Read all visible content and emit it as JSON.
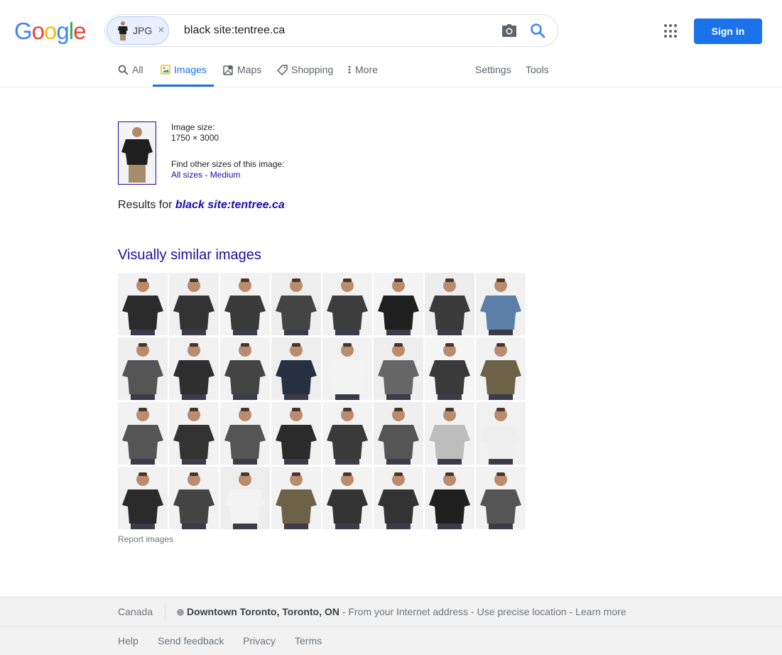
{
  "logo": {
    "letters": [
      "G",
      "o",
      "o",
      "g",
      "l",
      "e"
    ],
    "colors": [
      "#4285f4",
      "#ea4335",
      "#fbbc05",
      "#4285f4",
      "#34a853",
      "#ea4335"
    ]
  },
  "search": {
    "chip_label": "JPG",
    "chip_close": "×",
    "query": "black site:tentree.ca"
  },
  "header": {
    "signin_label": "Sign in"
  },
  "tabs": [
    {
      "label": "All",
      "icon": "search-icon"
    },
    {
      "label": "Images",
      "icon": "image-icon",
      "active": true
    },
    {
      "label": "Maps",
      "icon": "map-icon"
    },
    {
      "label": "Shopping",
      "icon": "tag-icon"
    },
    {
      "label": "More",
      "icon": "more-vert-icon"
    }
  ],
  "tools": {
    "settings": "Settings",
    "tools": "Tools"
  },
  "image_info": {
    "size_label": "Image size:",
    "size_value": "1750 × 3000",
    "find_label": "Find other sizes of this image:",
    "all_sizes": "All sizes",
    "separator": " - ",
    "medium": "Medium"
  },
  "results": {
    "prefix": "Results for ",
    "query": "black site:tentree.ca"
  },
  "similar": {
    "title": "Visually similar images",
    "report": "Report images",
    "tiles": [
      {
        "shirt": "#2b2b2b",
        "bg": "#f2f2f2"
      },
      {
        "shirt": "#333",
        "bg": "#f0f0f0"
      },
      {
        "shirt": "#3a3a3a",
        "bg": "#f3f3f3"
      },
      {
        "shirt": "#444",
        "bg": "#eeeeee"
      },
      {
        "shirt": "#3d3d3d",
        "bg": "#f2f2f2"
      },
      {
        "shirt": "#1f1f1f",
        "bg": "#f4f4f4"
      },
      {
        "shirt": "#3a3a3a",
        "bg": "#ededed"
      },
      {
        "shirt": "#5b7fa8",
        "bg": "#f1f1f1"
      },
      {
        "shirt": "#555",
        "bg": "#efefef"
      },
      {
        "shirt": "#2e2e2e",
        "bg": "#f1f1f1"
      },
      {
        "shirt": "#444",
        "bg": "#f2f2f2"
      },
      {
        "shirt": "#263040",
        "bg": "#eeeeee"
      },
      {
        "shirt": "#f4f4f4",
        "bg": "#f2f2f2"
      },
      {
        "shirt": "#666",
        "bg": "#eeeeee"
      },
      {
        "shirt": "#3a3a3a",
        "bg": "#f5f5f5"
      },
      {
        "shirt": "#6b6248",
        "bg": "#f2f2f2"
      },
      {
        "shirt": "#555",
        "bg": "#f2f2f2"
      },
      {
        "shirt": "#333",
        "bg": "#f2f2f2"
      },
      {
        "shirt": "#555",
        "bg": "#f2f2f2"
      },
      {
        "shirt": "#2b2b2b",
        "bg": "#f2f2f2"
      },
      {
        "shirt": "#3a3a3a",
        "bg": "#f3f3f3"
      },
      {
        "shirt": "#555",
        "bg": "#efefef"
      },
      {
        "shirt": "#bdbdbd",
        "bg": "#f2f2f2"
      },
      {
        "shirt": "#eeeeee",
        "bg": "#f1f1f1"
      },
      {
        "shirt": "#2a2a2a",
        "bg": "#f1f1f1"
      },
      {
        "shirt": "#444",
        "bg": "#f2f2f2"
      },
      {
        "shirt": "#f3f3f3",
        "bg": "#eeeeee"
      },
      {
        "shirt": "#6b6248",
        "bg": "#f2f2f2"
      },
      {
        "shirt": "#333",
        "bg": "#f3f3f3"
      },
      {
        "shirt": "#333",
        "bg": "#f2f2f2"
      },
      {
        "shirt": "#1f1f1f",
        "bg": "#f2f2f2"
      },
      {
        "shirt": "#555",
        "bg": "#f2f2f2"
      }
    ]
  },
  "footer": {
    "country": "Canada",
    "location_bold": "Downtown Toronto, Toronto, ON",
    "location_rest": " - From your Internet address - Use precise location - Learn more",
    "links": [
      "Help",
      "Send feedback",
      "Privacy",
      "Terms"
    ]
  }
}
